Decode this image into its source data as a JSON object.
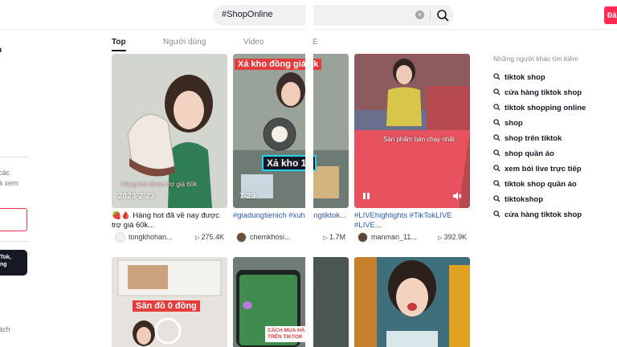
{
  "search": {
    "query": "#ShopOnline",
    "clear_glyph": "×",
    "icon": "search-icon"
  },
  "header": {
    "accent_label": "Đă",
    "accent_color": "#fe2c55"
  },
  "sidebar": {
    "heading": "n",
    "text_lines": [
      "các",
      "à xem"
    ],
    "promo_lines": [
      "Tok,",
      "ng"
    ],
    "bottom_text": "ách"
  },
  "tabs": [
    {
      "label": "Top",
      "active": true
    },
    {
      "label": "Người dùng",
      "active": false
    },
    {
      "label": "Video",
      "active": false
    },
    {
      "label": "E",
      "active": false
    }
  ],
  "videos": [
    {
      "date": "2023-2-23",
      "banner": "",
      "overlay": "Hàng hot được trợ giá 60k",
      "caption": "🍓🩸 Hàng hot đã về nay được trợ giá 60k...",
      "caption_tags": "",
      "author": "tongkhohan...",
      "views": "275.4K"
    },
    {
      "date": "7-29",
      "banner": "Xả kho đồng giá 9k",
      "overlay": "Xả kho 19",
      "caption": "",
      "caption_tags": "#giadungtienich #xuhuongtiktok...",
      "author": "chemkhosi...",
      "views": "1.7M"
    },
    {
      "date": "",
      "banner": "",
      "overlay": "Sản phẩm bán chạy nhất",
      "caption": "",
      "caption_tags": "#LIVEhighlights #TikTokLIVE #LIVE...",
      "author": "manman_11...",
      "views": "392.9K"
    },
    {
      "date": "",
      "banner": "Săn đồ 0 đồng",
      "overlay": "",
      "caption": "",
      "caption_tags": "",
      "author": "",
      "views": ""
    },
    {
      "date": "",
      "banner": "",
      "overlay": "CÁCH MUA HÀ TRÊN TIKTOK",
      "caption": "",
      "caption_tags": "",
      "author": "",
      "views": ""
    },
    {
      "date": "",
      "banner": "",
      "overlay": "",
      "caption": "",
      "caption_tags": "",
      "author": "",
      "views": ""
    }
  ],
  "others_searched": {
    "title": "Những người khác tìm kiếm",
    "items": [
      "tiktok shop",
      "cửa hàng tiktok shop",
      "tiktok shopping online",
      "shop",
      "shop trên tiktok",
      "shop quần áo",
      "xem bói live trực tiếp",
      "tiktok shop quần áo",
      "tiktokshop",
      "cửa hàng tiktok shop"
    ]
  }
}
